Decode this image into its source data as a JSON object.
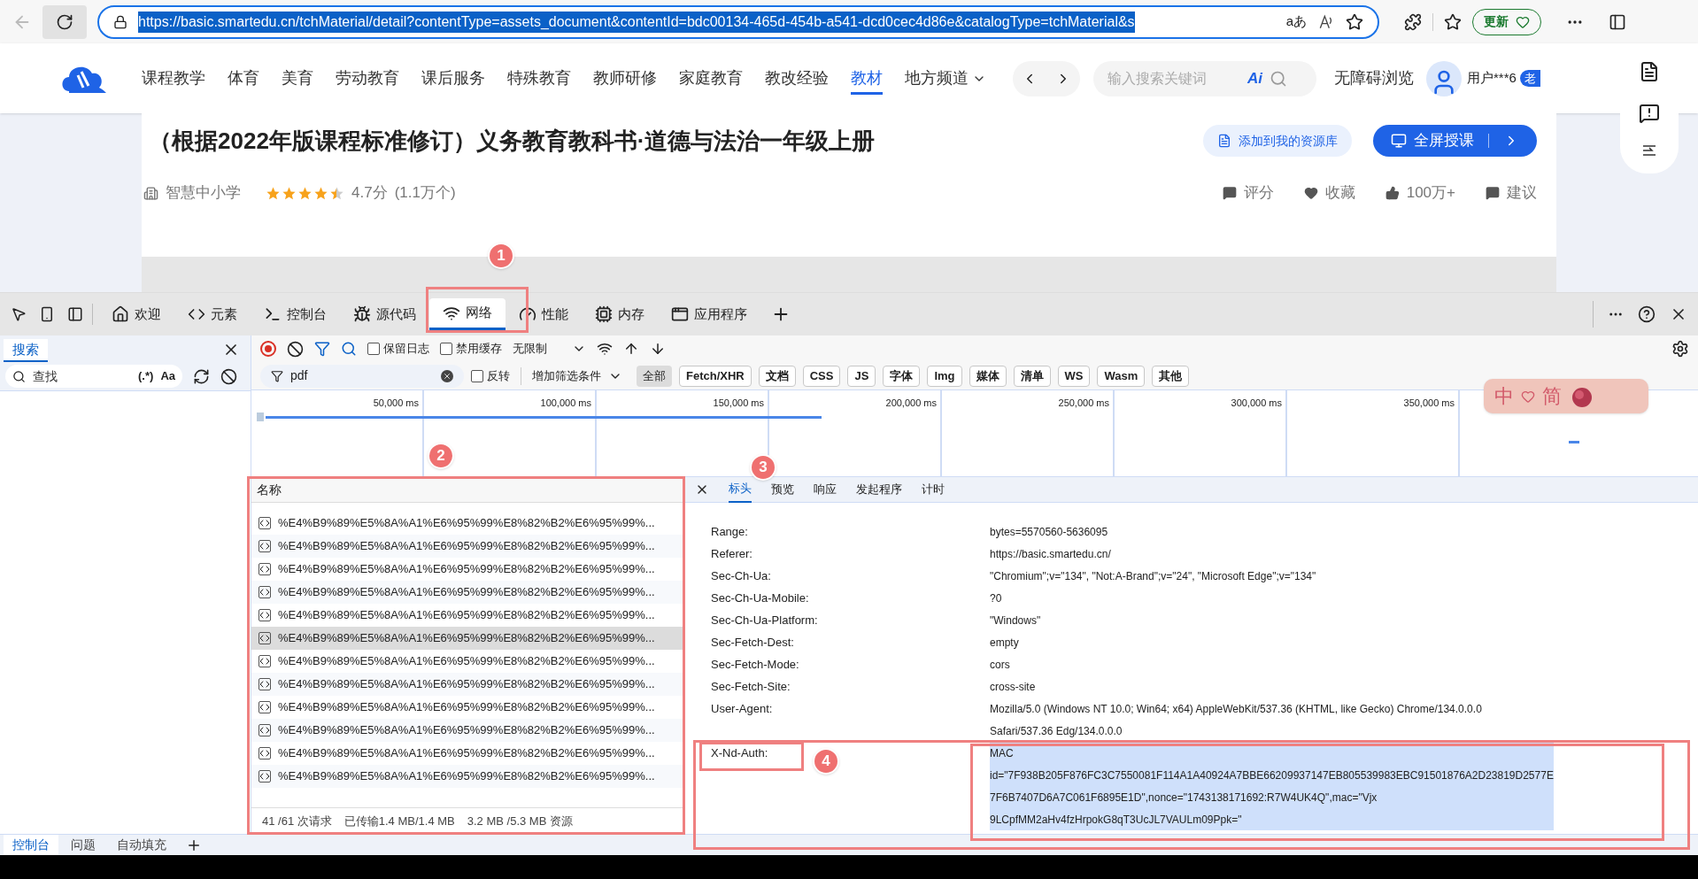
{
  "browser": {
    "url": "https://basic.smartedu.cn/tchMaterial/detail?contentType=assets_document&contentId=bdc00134-465d-454b-a541-dcd0cec4d86e&catalogType=tchMaterial&s",
    "update_button": "更新",
    "translate_label": "aあ"
  },
  "site": {
    "nav": [
      {
        "label": "课程教学",
        "selected": false
      },
      {
        "label": "体育",
        "selected": false
      },
      {
        "label": "美育",
        "selected": false
      },
      {
        "label": "劳动教育",
        "selected": false
      },
      {
        "label": "课后服务",
        "selected": false
      },
      {
        "label": "特殊教育",
        "selected": false
      },
      {
        "label": "教师研修",
        "selected": false
      },
      {
        "label": "家庭教育",
        "selected": false
      },
      {
        "label": "教改经验",
        "selected": false
      },
      {
        "label": "教材",
        "selected": true
      },
      {
        "label": "地方频道",
        "selected": false
      }
    ],
    "search_placeholder": "输入搜索关键词",
    "ai_label": "Ai",
    "accessibility": "无障碍浏览",
    "user": "用户***6",
    "user_badge": "老",
    "title": "（根据2022年版课程标准修订）义务教育教科书·道德与法治一年级上册",
    "add_button": "添加到我的资源库",
    "present_button": "全屏授课",
    "publisher": "智慧中小学",
    "stars": 4.5,
    "rating": "4.7分",
    "rating_count": "(1.1万个)",
    "actions": [
      "评分",
      "收藏",
      "100万+",
      "建议"
    ]
  },
  "devtools": {
    "tabs": [
      {
        "label": "欢迎",
        "selected": false
      },
      {
        "label": "元素",
        "selected": false
      },
      {
        "label": "控制台",
        "selected": false
      },
      {
        "label": "源代码",
        "selected": false
      },
      {
        "label": "网络",
        "selected": true
      },
      {
        "label": "性能",
        "selected": false
      },
      {
        "label": "内存",
        "selected": false
      },
      {
        "label": "应用程序",
        "selected": false
      }
    ],
    "search_tab": "搜索",
    "search_placeholder": "查找",
    "regex": "(.*)",
    "match_case": "Aa",
    "preserve_log": {
      "label": "保留日志",
      "checked": false
    },
    "disable_cache": {
      "label": "禁用缓存",
      "checked": false
    },
    "throttling": "无限制",
    "filter_value": "pdf",
    "invert": {
      "label": "反转",
      "checked": false
    },
    "more_filters": "增加筛选条件",
    "type_filters": [
      {
        "label": "全部",
        "selected": true
      },
      {
        "label": "Fetch/XHR",
        "selected": false
      },
      {
        "label": "文档",
        "selected": false
      },
      {
        "label": "CSS",
        "selected": false
      },
      {
        "label": "JS",
        "selected": false
      },
      {
        "label": "字体",
        "selected": false
      },
      {
        "label": "Img",
        "selected": false
      },
      {
        "label": "媒体",
        "selected": false
      },
      {
        "label": "清单",
        "selected": false
      },
      {
        "label": "WS",
        "selected": false
      },
      {
        "label": "Wasm",
        "selected": false
      },
      {
        "label": "其他",
        "selected": false
      }
    ],
    "timeline_ticks": [
      "50,000 ms",
      "100,000 ms",
      "150,000 ms",
      "200,000 ms",
      "250,000 ms",
      "300,000 ms",
      "350,000 ms"
    ],
    "list_header": "名称",
    "requests": [
      {
        "name": "%E4%B9%89%E5%8A%A1%E6%95%99%E8%82%B2%E6%95%99%...",
        "selected": false
      },
      {
        "name": "%E4%B9%89%E5%8A%A1%E6%95%99%E8%82%B2%E6%95%99%...",
        "selected": false
      },
      {
        "name": "%E4%B9%89%E5%8A%A1%E6%95%99%E8%82%B2%E6%95%99%...",
        "selected": false
      },
      {
        "name": "%E4%B9%89%E5%8A%A1%E6%95%99%E8%82%B2%E6%95%99%...",
        "selected": false
      },
      {
        "name": "%E4%B9%89%E5%8A%A1%E6%95%99%E8%82%B2%E6%95%99%...",
        "selected": false
      },
      {
        "name": "%E4%B9%89%E5%8A%A1%E6%95%99%E8%82%B2%E6%95%99%...",
        "selected": true
      },
      {
        "name": "%E4%B9%89%E5%8A%A1%E6%95%99%E8%82%B2%E6%95%99%...",
        "selected": false
      },
      {
        "name": "%E4%B9%89%E5%8A%A1%E6%95%99%E8%82%B2%E6%95%99%...",
        "selected": false
      },
      {
        "name": "%E4%B9%89%E5%8A%A1%E6%95%99%E8%82%B2%E6%95%99%...",
        "selected": false
      },
      {
        "name": "%E4%B9%89%E5%8A%A1%E6%95%99%E8%82%B2%E6%95%99%...",
        "selected": false
      },
      {
        "name": "%E4%B9%89%E5%8A%A1%E6%95%99%E8%82%B2%E6%95%99%...",
        "selected": false
      },
      {
        "name": "%E4%B9%89%E5%8A%A1%E6%95%99%E8%82%B2%E6%95%99%...",
        "selected": false
      }
    ],
    "summary": [
      "41 /61 次请求",
      "已传输1.4 MB/1.4 MB",
      "3.2 MB /5.3 MB 资源"
    ],
    "detail_tabs": [
      {
        "label": "标头",
        "selected": true
      },
      {
        "label": "预览",
        "selected": false
      },
      {
        "label": "响应",
        "selected": false
      },
      {
        "label": "发起程序",
        "selected": false
      },
      {
        "label": "计时",
        "selected": false
      }
    ],
    "headers": [
      {
        "name": "Range:",
        "value": [
          "bytes=5570560-5636095"
        ],
        "highlighted": false
      },
      {
        "name": "Referer:",
        "value": [
          "https://basic.smartedu.cn/"
        ],
        "highlighted": false
      },
      {
        "name": "Sec-Ch-Ua:",
        "value": [
          "\"Chromium\";v=\"134\", \"Not:A-Brand\";v=\"24\", \"Microsoft Edge\";v=\"134\""
        ],
        "highlighted": false
      },
      {
        "name": "Sec-Ch-Ua-Mobile:",
        "value": [
          "?0"
        ],
        "highlighted": false
      },
      {
        "name": "Sec-Ch-Ua-Platform:",
        "value": [
          "\"Windows\""
        ],
        "highlighted": false
      },
      {
        "name": "Sec-Fetch-Dest:",
        "value": [
          "empty"
        ],
        "highlighted": false
      },
      {
        "name": "Sec-Fetch-Mode:",
        "value": [
          "cors"
        ],
        "highlighted": false
      },
      {
        "name": "Sec-Fetch-Site:",
        "value": [
          "cross-site"
        ],
        "highlighted": false
      },
      {
        "name": "User-Agent:",
        "value": [
          "Mozilla/5.0 (Windows NT 10.0; Win64; x64) AppleWebKit/537.36 (KHTML, like Gecko) Chrome/134.0.0.0",
          "Safari/537.36 Edg/134.0.0.0"
        ],
        "highlighted": false
      },
      {
        "name": "X-Nd-Auth:",
        "value": [
          "MAC",
          "id=\"7F938B205F876FC3C7550081F114A1A40924A7BBE66209937147EB805539983EBC91501876A2D23819D2577E",
          "7F6B7407D6A7C061F6895E1D\",nonce=\"1743138171692:R7W4UK4Q\",mac=\"Vjx",
          "9LCpfMM2aHv4fzHrpokG8qT3UcJL7VAULm09Ppk=\""
        ],
        "highlighted": true
      }
    ],
    "drawer_tabs": [
      {
        "label": "控制台",
        "selected": true
      },
      {
        "label": "问题",
        "selected": false
      },
      {
        "label": "自动填充",
        "selected": false
      }
    ]
  },
  "ime_widget": {
    "mode": "中",
    "script": "简"
  },
  "annotations": [
    "1",
    "2",
    "3",
    "4"
  ]
}
